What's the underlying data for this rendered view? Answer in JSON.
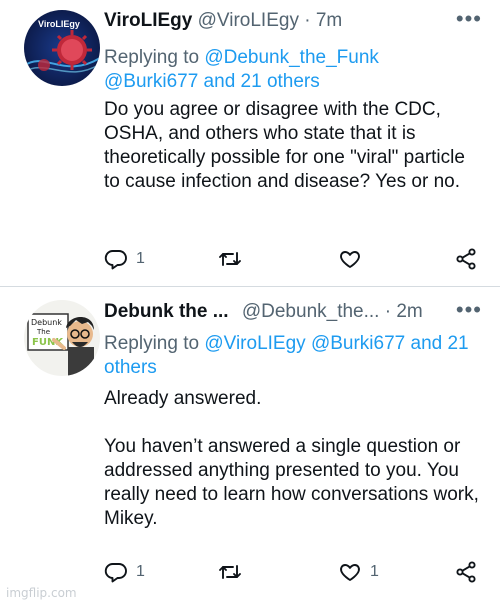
{
  "tweets": [
    {
      "display_name": "ViroLIEgy",
      "handle": "@ViroLIEgy",
      "time": "· 7m",
      "reply_prefix": "Replying to ",
      "reply_mentions": "@Debunk_the_Funk @Burki677 and 21 others",
      "text": "Do you agree or disagree with the CDC, OSHA, and others who state that it is theoretically possible for one \"viral\" particle to cause infection and disease? Yes or no.",
      "reply_count": "1",
      "retweet_count": "",
      "like_count": "",
      "avatar_text": "ViroLIEgy"
    },
    {
      "display_name": "Debunk the ...",
      "handle": "@Debunk_the...",
      "time": "· 2m",
      "reply_prefix": "Replying to ",
      "reply_mentions": "@ViroLIEgy @Burki677 and 21 others",
      "text": "Already answered.\n\nYou haven’t answered a single question or addressed anything presented to you. You really need to learn how conversations work, Mikey.",
      "reply_count": "1",
      "retweet_count": "",
      "like_count": "1",
      "avatar_text": "Debunk The Funk"
    }
  ],
  "more_glyph": "•••",
  "watermark": "imgflip.com",
  "colors": {
    "link": "#1d9bf0",
    "secondary": "#536471",
    "text": "#0f1419"
  }
}
